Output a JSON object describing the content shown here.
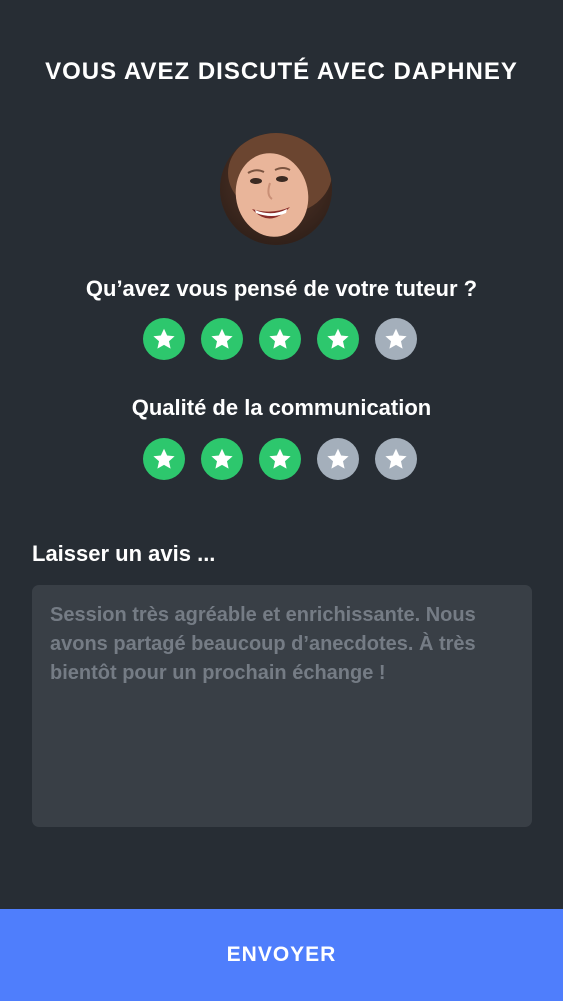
{
  "header": {
    "title": "VOUS AVEZ DISCUTÉ AVEC DAPHNEY"
  },
  "avatar": {
    "icon": "tutor-avatar"
  },
  "ratings": [
    {
      "question": "Qu’avez vous pensé de votre tuteur ?",
      "value": 4,
      "max": 5
    },
    {
      "question": "Qualité de la communication",
      "value": 3,
      "max": 5
    }
  ],
  "review": {
    "label": "Laisser un avis ...",
    "placeholder": "Session très agréable et enrichissante. Nous avons partagé beaucoup d’anecdotes. À très bientôt pour un prochain échange !"
  },
  "footer": {
    "send_label": "ENVOYER"
  },
  "colors": {
    "background": "#272d34",
    "star_on": "#2dc76d",
    "star_off": "#a4afbb",
    "button": "#4f7efc",
    "field": "#393f46"
  }
}
